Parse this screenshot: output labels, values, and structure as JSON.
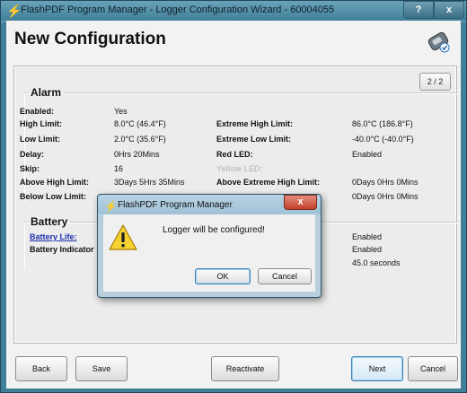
{
  "window": {
    "title": "FlashPDF Program Manager - Logger Configuration Wizard - 60004055",
    "help_button": "?",
    "close_button": "x"
  },
  "page": {
    "title": "New Configuration",
    "pager": "2 / 2"
  },
  "alarm": {
    "legend": "Alarm",
    "left_rows": [
      {
        "label": "Enabled:",
        "value": "Yes"
      },
      {
        "label": "High Limit:",
        "value": "8.0°C (46.4°F)"
      },
      {
        "label": "Low Limit:",
        "value": "2.0°C (35.6°F)"
      },
      {
        "label": "Delay:",
        "value": "0Hrs 20Mins"
      },
      {
        "label": "Skip:",
        "value": "16"
      },
      {
        "label": "Above High Limit:",
        "value": "3Days 5Hrs 35Mins"
      },
      {
        "label": "Below Low Limit:",
        "value": ""
      }
    ],
    "right_rows": [
      {
        "label": "Extreme High Limit:",
        "value": "86.0°C (186.8°F)"
      },
      {
        "label": "Extreme Low Limit:",
        "value": "-40.0°C (-40.0°F)"
      },
      {
        "label": "Red LED:",
        "value": "Enabled"
      },
      {
        "label": "Yellow LED:",
        "value": ""
      },
      {
        "label": "Above Extreme High Limit:",
        "value": "0Days 0Hrs 0Mins"
      },
      {
        "label": "",
        "value": "0Days 0Hrs 0Mins"
      }
    ]
  },
  "battery": {
    "legend": "Battery",
    "battery_life_label": "Battery Life:",
    "battery_indicator_label": "Battery Indicator",
    "right_values": [
      "Enabled",
      "Enabled",
      "45.0 seconds"
    ]
  },
  "buttons": {
    "back": "Back",
    "save": "Save",
    "reactivate": "Reactivate",
    "next": "Next",
    "cancel": "Cancel"
  },
  "dialog": {
    "title": "FlashPDF Program Manager",
    "message": "Logger will be configured!",
    "ok": "OK",
    "cancel": "Cancel",
    "close": "x"
  },
  "icons": {
    "app": "lightning-icon",
    "header": "logger-device-icon",
    "dialog": "warning-icon"
  }
}
